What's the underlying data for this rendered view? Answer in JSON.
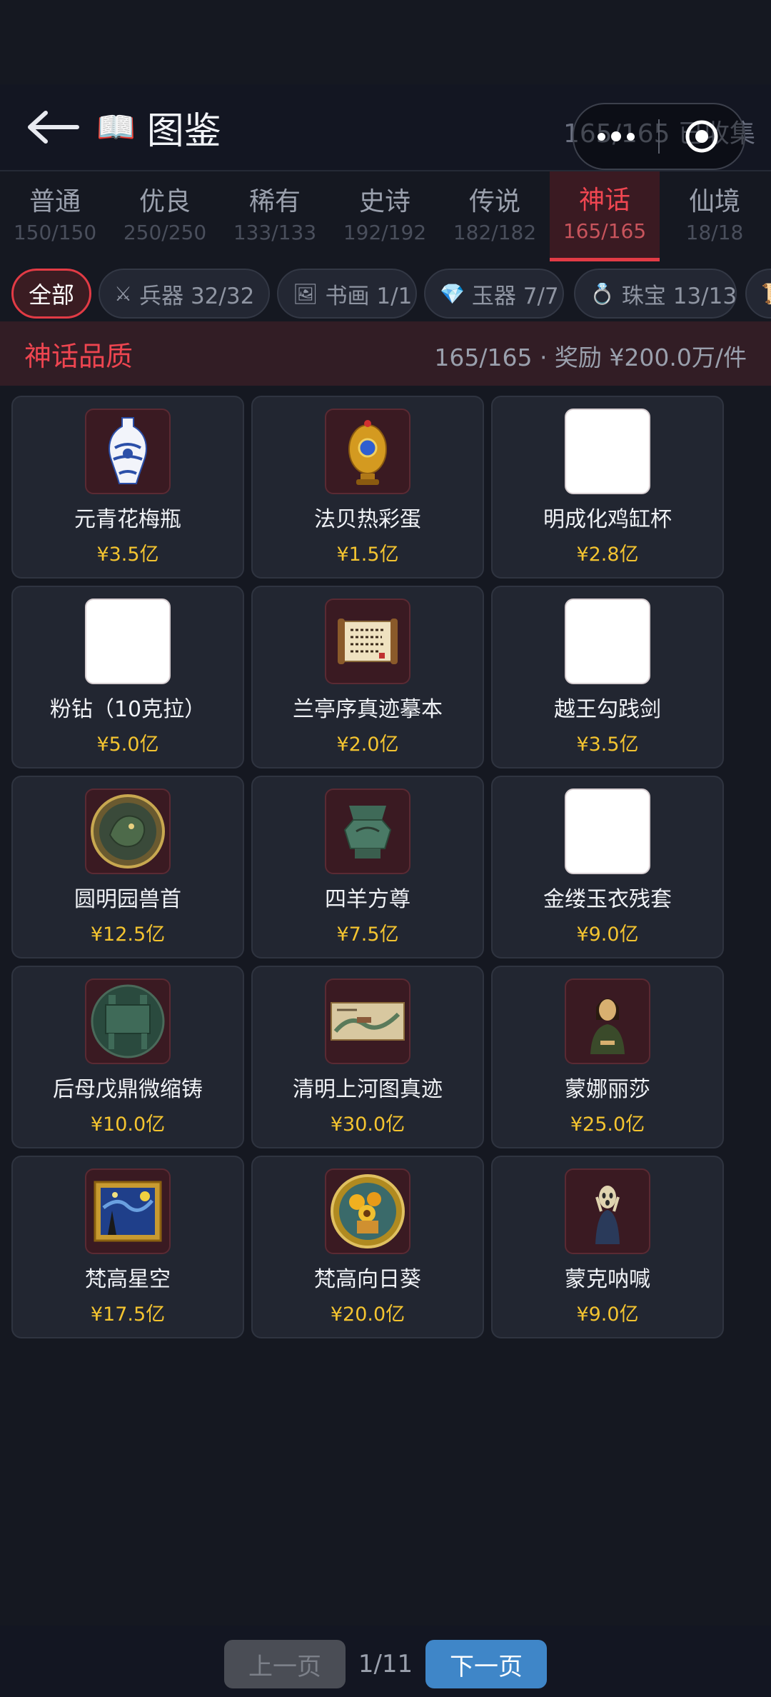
{
  "header": {
    "title": "图鉴",
    "book_icon": "📖",
    "progress": "165/165 已收集"
  },
  "tiers": [
    {
      "name": "普通",
      "count": "150/150"
    },
    {
      "name": "优良",
      "count": "250/250"
    },
    {
      "name": "稀有",
      "count": "133/133"
    },
    {
      "name": "史诗",
      "count": "192/192"
    },
    {
      "name": "传说",
      "count": "182/182"
    },
    {
      "name": "神话",
      "count": "165/165"
    },
    {
      "name": "仙境",
      "count": "18/18"
    }
  ],
  "filters": [
    {
      "icon": "",
      "label": "全部"
    },
    {
      "icon": "⚔",
      "label": "兵器 32/32"
    },
    {
      "icon": "🖼",
      "label": "书画 1/1"
    },
    {
      "icon": "💎",
      "label": "玉器 7/7"
    },
    {
      "icon": "💍",
      "label": "珠宝 13/13"
    },
    {
      "icon": "📜",
      "label": ""
    }
  ],
  "quality": {
    "title": "神话品质",
    "stats": "165/165 · 奖励 ¥200.0万/件"
  },
  "items": [
    {
      "name": "元青花梅瓶",
      "price": "¥3.5亿"
    },
    {
      "name": "法贝热彩蛋",
      "price": "¥1.5亿"
    },
    {
      "name": "明成化鸡缸杯",
      "price": "¥2.8亿"
    },
    {
      "name": "粉钻（10克拉）",
      "price": "¥5.0亿"
    },
    {
      "name": "兰亭序真迹摹本",
      "price": "¥2.0亿"
    },
    {
      "name": "越王勾践剑",
      "price": "¥3.5亿"
    },
    {
      "name": "圆明园兽首",
      "price": "¥12.5亿"
    },
    {
      "name": "四羊方尊",
      "price": "¥7.5亿"
    },
    {
      "name": "金缕玉衣残套",
      "price": "¥9.0亿"
    },
    {
      "name": "后母戊鼎微缩铸",
      "price": "¥10.0亿"
    },
    {
      "name": "清明上河图真迹",
      "price": "¥30.0亿"
    },
    {
      "name": "蒙娜丽莎",
      "price": "¥25.0亿"
    },
    {
      "name": "梵高星空",
      "price": "¥17.5亿"
    },
    {
      "name": "梵高向日葵",
      "price": "¥20.0亿"
    },
    {
      "name": "蒙克呐喊",
      "price": "¥9.0亿"
    }
  ],
  "pager": {
    "prev": "上一页",
    "page": "1/11",
    "next": "下一页"
  }
}
